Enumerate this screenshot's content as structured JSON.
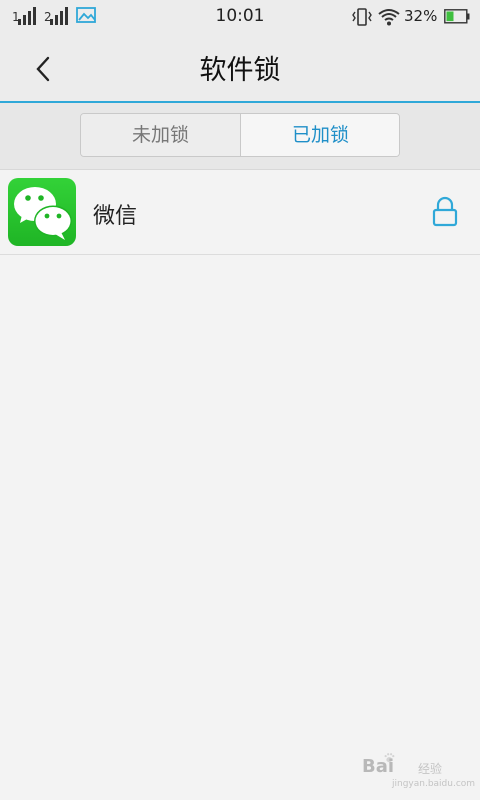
{
  "status_bar": {
    "time": "10:01",
    "signal1_label": "1",
    "signal2_label": "2",
    "battery_percent": "32%",
    "icons": [
      "signal-icon",
      "signal-icon",
      "gallery-notification-icon",
      "vibrate-icon",
      "wifi-icon",
      "battery-icon"
    ]
  },
  "header": {
    "title": "软件锁",
    "back_icon": "chevron-left-icon"
  },
  "tabs": [
    {
      "label": "未加锁",
      "selected": false
    },
    {
      "label": "已加锁",
      "selected": true
    }
  ],
  "apps": [
    {
      "name": "微信",
      "icon": "wechat-icon",
      "lock_icon": "lock-icon"
    }
  ],
  "watermark": {
    "brand": "Bai",
    "brand2": "经验",
    "url": "jingyan.baidu.com"
  },
  "colors": {
    "accent": "#2fa8d8",
    "selected_tab_text": "#1f8fc8",
    "wechat_green": "#2bc52f"
  }
}
